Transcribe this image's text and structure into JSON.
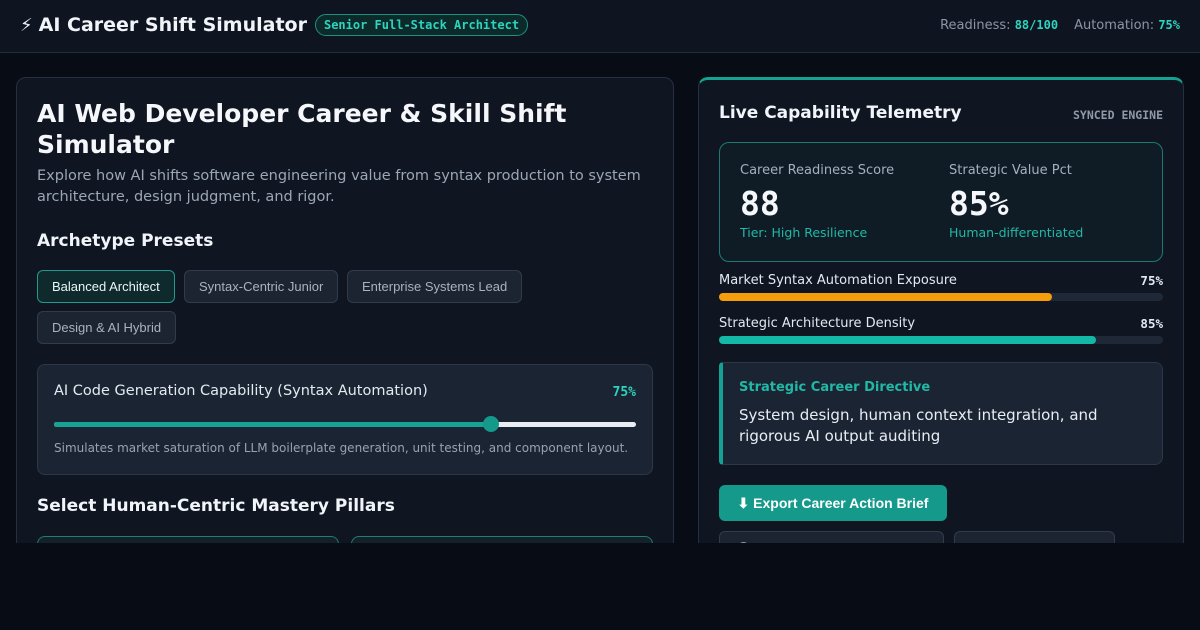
{
  "header": {
    "title": "AI Career Shift Simulator",
    "role_badge": "Senior Full-Stack Architect",
    "readiness_label": "Readiness:",
    "readiness_value": "88/100",
    "automation_label": "Automation:",
    "automation_value": "75%",
    "logo_icon": "lightning-bolt-icon"
  },
  "main": {
    "title": "AI Web Developer Career & Skill Shift Simulator",
    "subtitle": "Explore how AI shifts software engineering value from syntax production to system architecture, design judgment, and rigor.",
    "presets_heading": "Archetype Presets",
    "presets": [
      {
        "label": "Balanced Architect",
        "active": true
      },
      {
        "label": "Syntax-Centric Junior",
        "active": false
      },
      {
        "label": "Enterprise Systems Lead",
        "active": false
      },
      {
        "label": "Design & AI Hybrid",
        "active": false
      }
    ],
    "slider": {
      "label": "AI Code Generation Capability (Syntax Automation)",
      "value_text": "75%",
      "value": 0.75,
      "description": "Simulates market saturation of LLM boilerplate generation, unit testing, and component layout."
    },
    "pillars_heading": "Select Human-Centric Mastery Pillars"
  },
  "telemetry": {
    "title": "Live Capability Telemetry",
    "status": "SYNCED ENGINE",
    "readiness": {
      "label": "Career Readiness Score",
      "value": "88",
      "sub": "Tier: High Resilience"
    },
    "value_pct": {
      "label": "Strategic Value Pct",
      "value": "85%",
      "sub": "Human-differentiated"
    },
    "bars": [
      {
        "label": "Market Syntax Automation Exposure",
        "value_text": "75%",
        "value": 0.75,
        "color": "#f59e0b"
      },
      {
        "label": "Strategic Architecture Density",
        "value_text": "85%",
        "value": 0.85,
        "color": "#14b8a6"
      }
    ],
    "directive": {
      "heading": "Strategic Career Directive",
      "text": "System design, human context integration, and rigorous AI output auditing"
    },
    "export_label": "⬇ Export Career Action Brief"
  },
  "colors": {
    "accent": "#14b8a6",
    "warning": "#f59e0b",
    "background": "#080c14"
  }
}
